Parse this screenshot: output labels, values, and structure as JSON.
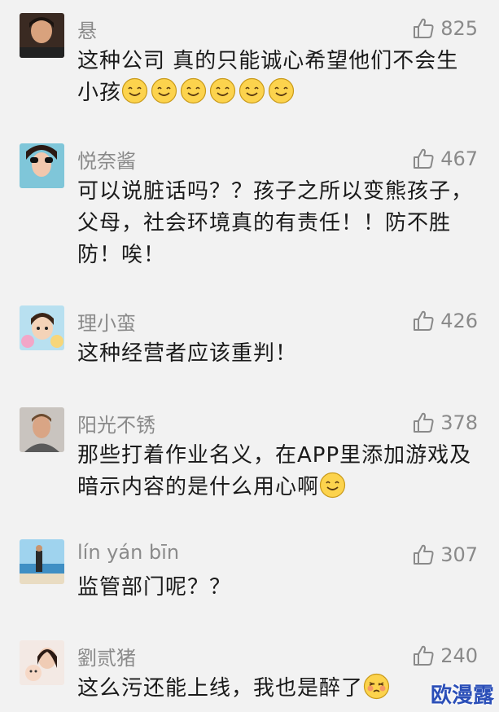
{
  "comments": [
    {
      "name": "悬",
      "likes": "825",
      "text": "这种公司 真的只能诚心希望他们不会生小孩",
      "emoji": "smile-emoji",
      "emoji_count": 6
    },
    {
      "name": "悦奈酱",
      "likes": "467",
      "text": "可以说脏话吗？？孩子之所以变熊孩子，父母，社会环境真的有责任！！防不胜防！唉！"
    },
    {
      "name": "理小蛮",
      "likes": "426",
      "text": "这种经营者应该重判！"
    },
    {
      "name": "阳光不锈",
      "likes": "378",
      "text": "那些打着作业名义，在APP里添加游戏及暗示内容的是什么用心啊",
      "emoji": "smile-emoji",
      "emoji_count": 1
    },
    {
      "name": "lín yán bīn",
      "likes": "307",
      "text": "监管部门呢？？"
    },
    {
      "name": "劉贰猪",
      "likes": "240",
      "text": "这么污还能上线，我也是醉了",
      "emoji": "drunk-emoji",
      "emoji_count": 1
    }
  ],
  "icons": {
    "like": "thumbs-up-icon"
  },
  "colors": {
    "background": "#f2f2f2",
    "name_text": "#8a8a8a",
    "body_text": "#1a1a1a",
    "watermark": "#2b4fb8"
  },
  "watermark": "欧漫露"
}
